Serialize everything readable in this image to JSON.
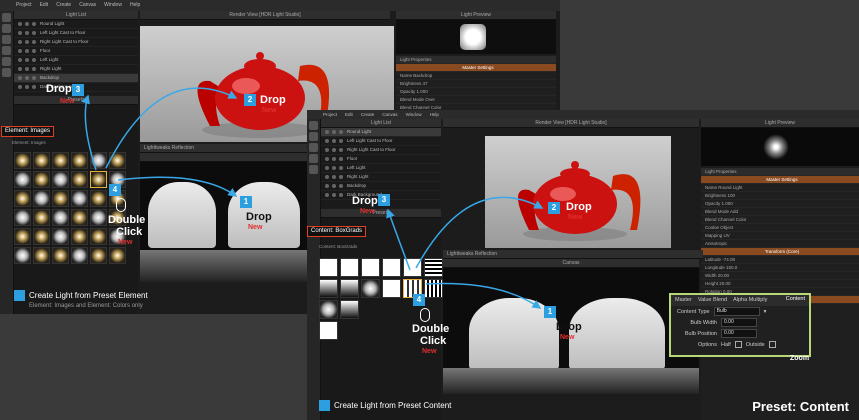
{
  "menu": [
    "Project",
    "Edit",
    "Create",
    "Canvas",
    "Window",
    "Help"
  ],
  "panels": {
    "light_list_title": "Light List",
    "render_view_title": "Render View [HDR Light Studio]",
    "light_preview_title": "Light Preview",
    "canvas_title": "Canvas",
    "presets_title": "Presets",
    "light_properties_tab": "Light Properties",
    "render_view_settings_tab": "Render View Settings",
    "lighttweaks_tab": "Lighttweaks Reflection",
    "frame_label": "Frame 0",
    "master_settings": "Master Settings"
  },
  "light_list_back": [
    "Round Light",
    "Left Light Cast to Floor",
    "Right Light Cast to Floor",
    "Floor",
    "Left Light",
    "Right Light",
    "Backdrop",
    "Dark Background"
  ],
  "light_list_front": [
    "Round Light",
    "Left Light Cast to Floor",
    "Right Light Cast to Floor",
    "Floor",
    "Left Light",
    "Right Light",
    "Backdrop",
    "Dark Background"
  ],
  "back_props": [
    "Name  Backdrop",
    "Brightness  47",
    "Opacity  1.000",
    "Blend Mode  Over",
    "Blend Channel  Color"
  ],
  "front_props": [
    "Name  Round Light",
    "Brightness  100",
    "Opacity  1.000",
    "Blend Mode  Add",
    "Blend Channel  Color",
    "Cookie  Object",
    "Mapping  UV",
    "Anisotropic",
    "Latitude  -74.08",
    "Longitude  150.0",
    "Width  20.00",
    "Height  20.00",
    "Rotation  0.00"
  ],
  "front_sections": [
    "Transform (Core)",
    "Transform (Extended)"
  ],
  "steps_back": {
    "drop3": "Drop",
    "drop3_num": "3",
    "drop3_new": "New",
    "drop2": "Drop",
    "drop2_num": "2",
    "drop2_new": "New",
    "drop1": "Drop",
    "drop1_num": "1",
    "drop1_new": "New",
    "double_num": "4",
    "double": "Double",
    "click": "Click",
    "click_new": "New"
  },
  "steps_front": {
    "drop3": "Drop",
    "drop3_num": "3",
    "drop3_new": "New",
    "drop2": "Drop",
    "drop2_num": "2",
    "drop2_new": "New",
    "drop1": "Drop",
    "drop1_num": "1",
    "drop1_new": "New",
    "double_num": "4",
    "double": "Double",
    "click": "Click",
    "click_new": "New"
  },
  "element_images_label": "Element: Images",
  "element_sub_label": "Element: Images",
  "content_boxgrads_label": "Content: BoxGrads",
  "content_sub_label": "Content: BoxGrads",
  "caption_back": "Create Light from Preset Element",
  "caption_back_sub": "Element: Images and Element: Colors only",
  "caption_front": "Create Light from Preset Content",
  "preset_title": "Preset: Content",
  "zoom_label": "Zoom",
  "content_box": {
    "title": "Content",
    "tabs": [
      "Master",
      "Value Blend",
      "Alpha Multiply"
    ],
    "content_type_label": "Content Type",
    "content_type_value": "Bulb",
    "bulb_width_label": "Bulb Width",
    "bulb_width_value": "0.00",
    "bulb_position_label": "Bulb Position",
    "bulb_position_value": "0.00",
    "options_label": "Options",
    "half_label": "Half",
    "outside_label": "Outside"
  },
  "colors": {
    "accent": "#2b9fe0",
    "new_red": "#e03030",
    "highlight_green": "#b8d878",
    "label_box": "#e04020"
  }
}
